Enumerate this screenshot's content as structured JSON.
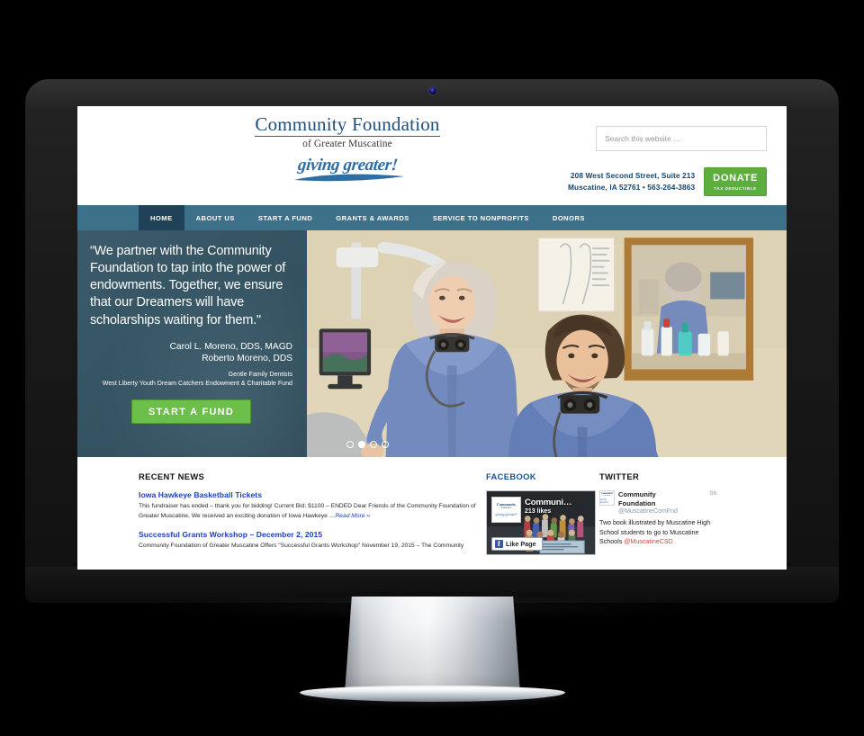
{
  "device": {
    "type": "desktop-monitor",
    "bezel_color": "#1b1b1b",
    "stand_color": "#d8dde2"
  },
  "header": {
    "logo_main": "Community Foundation",
    "logo_sub": "of Greater Muscatine",
    "tagline": "giving greater!",
    "search": {
      "placeholder": "Search this website …",
      "value": ""
    },
    "address_line1": "208 West Second Street, Suite 213",
    "address_line2": "Muscatine, IA 52761 • 563-264-3863",
    "donate": {
      "label": "DONATE",
      "sublabel": "TAX DEDUCTIBLE",
      "color": "#5cae3e"
    }
  },
  "nav": {
    "active_index": 0,
    "bar_color": "#3d7089",
    "active_color": "#1f4258",
    "items": [
      {
        "label": "HOME"
      },
      {
        "label": "ABOUT US"
      },
      {
        "label": "START A FUND"
      },
      {
        "label": "GRANTS & AWARDS"
      },
      {
        "label": "SERVICE TO NONPROFITS"
      },
      {
        "label": "DONORS"
      }
    ]
  },
  "hero": {
    "quote": "“We partner with the Community Foundation to tap into the power of endowments. Together, we ensure that our Dreamers will have scholarships waiting for them.\"",
    "attribution_line1": "Carol L. Moreno, DDS, MAGD",
    "attribution_line2": "Roberto Moreno, DDS",
    "org_line1": "Gentle Family Dentists",
    "org_line2": "West Liberty Youth Dream Catchers Endowment & Charitable Fund",
    "cta_label": "START A FUND",
    "cta_color": "#6cc04a",
    "slide_count": 4,
    "active_slide": 2,
    "image_alt": "Two dentists in blue scrubs standing in a dental office"
  },
  "news": {
    "section_title": "RECENT NEWS",
    "posts": [
      {
        "title": "Iowa Hawkeye Basketball Tickets",
        "excerpt": "This fundraiser has ended – thank you for bidding! Current Bid: $1100 – ENDED Dear Friends of the Community Foundation of Greater Muscatine, We received an exciting donation of Iowa Hawkeye …",
        "read_more": "Read More »"
      },
      {
        "title": "Successful Grants Workshop – December 2, 2015",
        "excerpt": "Community Foundation of Greater Muscatine Offers \"Successful Grants Workshop\" November 19, 2015 – The Community",
        "read_more": ""
      }
    ]
  },
  "facebook": {
    "section_title": "FACEBOOK",
    "page_name": "Communi…",
    "likes": "213 likes",
    "like_button": "Like Page",
    "logo_line1": "Community",
    "logo_line2": "Foundation",
    "logo_line3": "of Greater Muscatine",
    "logo_tagline": "giving greater!"
  },
  "twitter": {
    "section_title": "TWITTER",
    "name_line1": "Community",
    "name_line2": "Foundation",
    "handle": "@MuscatineComFnd",
    "time": "5h",
    "tweet_text": "Two book illustrated by Muscatine High School students to go to Muscatine Schools ",
    "tweet_mention": "@MuscatineCSD"
  }
}
